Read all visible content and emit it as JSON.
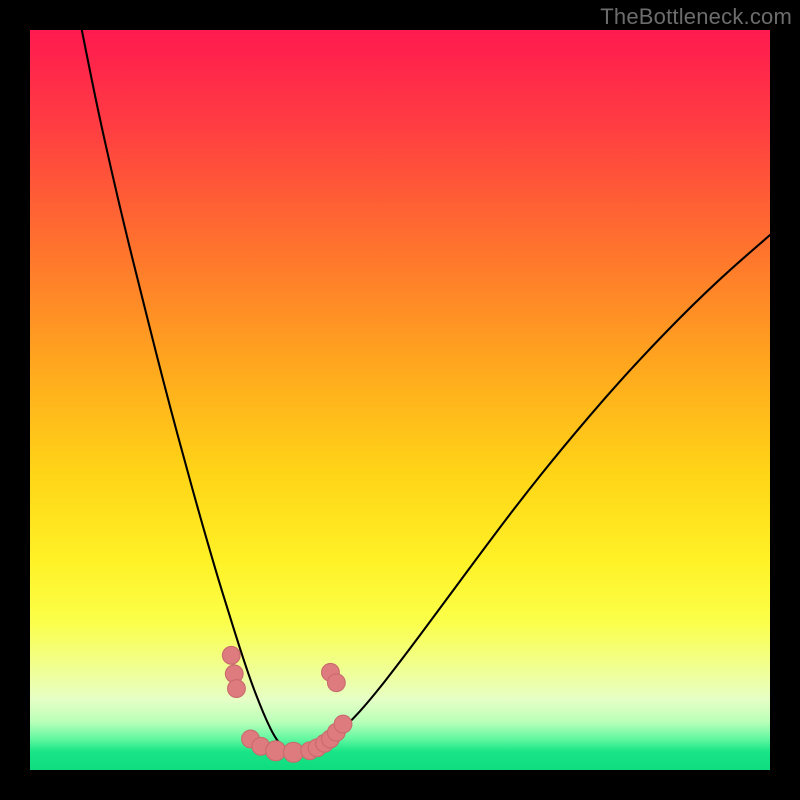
{
  "watermark": {
    "text": "TheBottleneck.com"
  },
  "colors": {
    "frame": "#000000",
    "curve": "#000000",
    "marker_fill": "#dd7b7e",
    "marker_stroke": "#c96a6d"
  },
  "chart_data": {
    "type": "line",
    "title": "",
    "xlabel": "",
    "ylabel": "",
    "xlim": [
      0,
      100
    ],
    "ylim": [
      0,
      100
    ],
    "grid": false,
    "legend": false,
    "background_gradient_stops": [
      {
        "offset": 0.0,
        "color": "#ff1a4f"
      },
      {
        "offset": 0.12,
        "color": "#ff3a43"
      },
      {
        "offset": 0.28,
        "color": "#ff6e2f"
      },
      {
        "offset": 0.45,
        "color": "#ffa61e"
      },
      {
        "offset": 0.6,
        "color": "#ffd517"
      },
      {
        "offset": 0.72,
        "color": "#fff227"
      },
      {
        "offset": 0.8,
        "color": "#fbff4a"
      },
      {
        "offset": 0.86,
        "color": "#f1ff8f"
      },
      {
        "offset": 0.905,
        "color": "#e6ffc6"
      },
      {
        "offset": 0.935,
        "color": "#b9ffb9"
      },
      {
        "offset": 0.958,
        "color": "#62f7a0"
      },
      {
        "offset": 0.975,
        "color": "#19e587"
      },
      {
        "offset": 1.0,
        "color": "#0fdc7e"
      }
    ],
    "series": [
      {
        "name": "bottleneck-curve",
        "x": [
          7.0,
          9.0,
          11.0,
          13.0,
          15.0,
          17.0,
          19.0,
          21.0,
          23.0,
          25.0,
          26.0,
          27.0,
          28.0,
          29.0,
          30.0,
          31.0,
          32.0,
          33.0,
          34.0,
          35.0,
          36.0,
          38.0,
          40.0,
          43.0,
          46.0,
          50.0,
          55.0,
          60.0,
          66.0,
          72.0,
          79.0,
          86.0,
          93.0,
          100.0
        ],
        "y": [
          100.0,
          90.0,
          81.0,
          72.5,
          64.5,
          56.5,
          48.8,
          41.4,
          34.2,
          27.3,
          24.0,
          20.8,
          17.6,
          14.5,
          11.6,
          9.0,
          6.6,
          4.6,
          3.2,
          2.4,
          2.2,
          2.5,
          3.6,
          6.2,
          9.5,
          14.6,
          21.3,
          28.1,
          36.1,
          43.6,
          51.8,
          59.3,
          66.2,
          72.3
        ]
      }
    ],
    "markers": [
      {
        "x": 27.2,
        "y": 15.5,
        "r": 1.2
      },
      {
        "x": 27.6,
        "y": 13.0,
        "r": 1.2
      },
      {
        "x": 27.9,
        "y": 11.0,
        "r": 1.2
      },
      {
        "x": 29.8,
        "y": 4.2,
        "r": 1.2
      },
      {
        "x": 31.2,
        "y": 3.2,
        "r": 1.2
      },
      {
        "x": 33.2,
        "y": 2.6,
        "r": 1.35
      },
      {
        "x": 35.6,
        "y": 2.4,
        "r": 1.35
      },
      {
        "x": 37.8,
        "y": 2.6,
        "r": 1.2
      },
      {
        "x": 38.8,
        "y": 3.0,
        "r": 1.2
      },
      {
        "x": 39.8,
        "y": 3.6,
        "r": 1.2
      },
      {
        "x": 40.6,
        "y": 4.2,
        "r": 1.2
      },
      {
        "x": 41.4,
        "y": 5.1,
        "r": 1.2
      },
      {
        "x": 42.3,
        "y": 6.2,
        "r": 1.2
      },
      {
        "x": 40.6,
        "y": 13.2,
        "r": 1.2
      },
      {
        "x": 41.4,
        "y": 11.8,
        "r": 1.2
      }
    ]
  }
}
